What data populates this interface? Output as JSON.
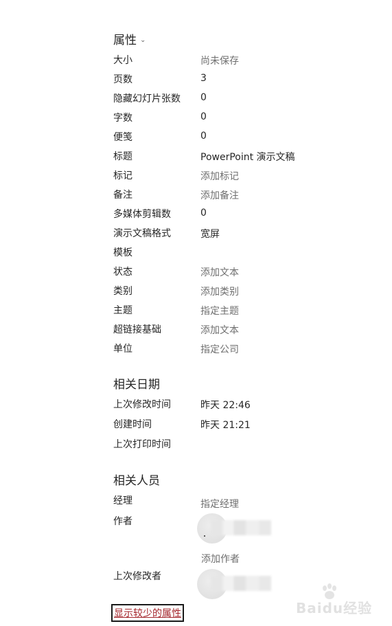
{
  "properties": {
    "title": "属性",
    "chevron_icon": "chevron-down-icon",
    "rows": [
      {
        "label": "大小",
        "value": "尚未保存",
        "placeholder": true
      },
      {
        "label": "页数",
        "value": "3",
        "placeholder": false
      },
      {
        "label": "隐藏幻灯片张数",
        "value": "0",
        "placeholder": false
      },
      {
        "label": "字数",
        "value": "0",
        "placeholder": false
      },
      {
        "label": "便笺",
        "value": "0",
        "placeholder": false
      },
      {
        "label": "标题",
        "value": "PowerPoint 演示文稿",
        "placeholder": false
      },
      {
        "label": "标记",
        "value": "添加标记",
        "placeholder": true
      },
      {
        "label": "备注",
        "value": "添加备注",
        "placeholder": true
      },
      {
        "label": "多媒体剪辑数",
        "value": "0",
        "placeholder": false
      },
      {
        "label": "演示文稿格式",
        "value": "宽屏",
        "placeholder": false
      },
      {
        "label": "模板",
        "value": "",
        "placeholder": false
      },
      {
        "label": "状态",
        "value": "添加文本",
        "placeholder": true
      },
      {
        "label": "类别",
        "value": "添加类别",
        "placeholder": true
      },
      {
        "label": "主题",
        "value": "指定主题",
        "placeholder": true
      },
      {
        "label": "超链接基础",
        "value": "添加文本",
        "placeholder": true
      },
      {
        "label": "单位",
        "value": "指定公司",
        "placeholder": true
      }
    ]
  },
  "dates": {
    "title": "相关日期",
    "rows": [
      {
        "label": "上次修改时间",
        "value": "昨天 22:46"
      },
      {
        "label": "创建时间",
        "value": "昨天 21:21"
      },
      {
        "label": "上次打印时间",
        "value": ""
      }
    ]
  },
  "people": {
    "title": "相关人员",
    "manager_label": "经理",
    "manager_value": "指定经理",
    "author_label": "作者",
    "add_author": "添加作者",
    "last_modified_by_label": "上次修改者"
  },
  "footer": {
    "show_less": "显示较少的属性"
  },
  "watermark": {
    "text": "Baidu经验",
    "icon": "baidu-paw-icon"
  },
  "colors": {
    "placeholder_text": "#6f6f6f",
    "link": "#a4262c",
    "text": "#262626"
  }
}
